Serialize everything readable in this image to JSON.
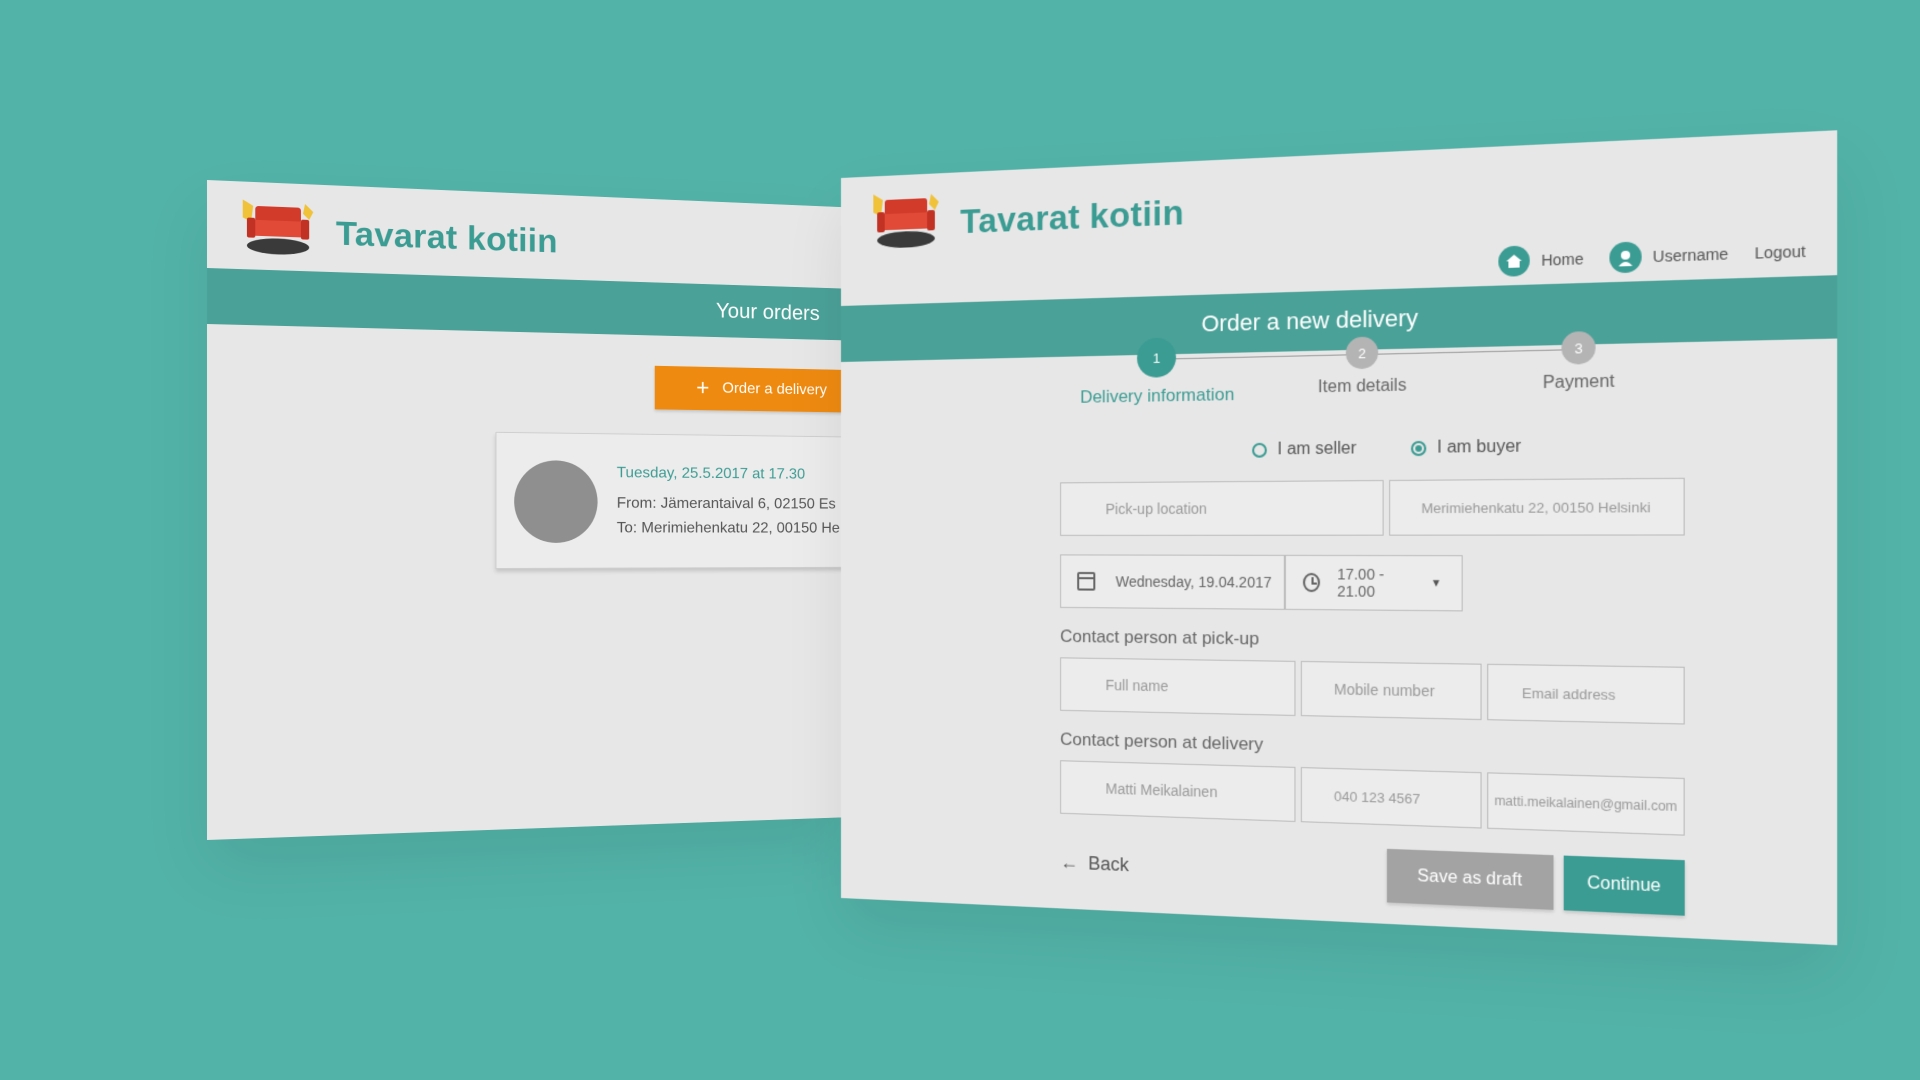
{
  "brand": {
    "name": "Tavarat kotiin"
  },
  "left_screen": {
    "band_title": "Your orders",
    "order_button": {
      "icon": "plus-icon",
      "label": "Order a delivery"
    },
    "order": {
      "date": "Tuesday, 25.5.2017 at 17.30",
      "from": "From: Jämerantaival 6, 02150 Es",
      "to": "To: Merimiehenkatu 22, 00150 He"
    }
  },
  "right_screen": {
    "nav": {
      "home": "Home",
      "username": "Username",
      "logout": "Logout"
    },
    "band_title": "Order a new delivery",
    "steps": [
      {
        "number": "1",
        "label": "Delivery information",
        "active": true
      },
      {
        "number": "2",
        "label": "Item details",
        "active": false
      },
      {
        "number": "3",
        "label": "Payment",
        "active": false
      }
    ],
    "roles": {
      "seller": "I am seller",
      "buyer": "I am buyer",
      "selected": "buyer"
    },
    "pickup": {
      "placeholder": "Pick-up location",
      "delivery_value": "Merimiehenkatu 22, 00150 Helsinki"
    },
    "schedule": {
      "date": "Wednesday, 19.04.2017",
      "time": "17.00 - 21.00"
    },
    "contact_pickup": {
      "label": "Contact person at pick-up",
      "full_name_placeholder": "Full name",
      "mobile_placeholder": "Mobile number",
      "email_placeholder": "Email address"
    },
    "contact_delivery": {
      "label": "Contact person at delivery",
      "full_name": "Matti Meikalainen",
      "mobile": "040 123 4567",
      "email": "matti.meikalainen@gmail.com"
    },
    "buttons": {
      "back": "Back",
      "draft": "Save as draft",
      "continue": "Continue"
    }
  },
  "colors": {
    "background": "#52b3a8",
    "accent": "#3b9c93",
    "band": "#4aa198",
    "orange": "#ef8a10"
  }
}
